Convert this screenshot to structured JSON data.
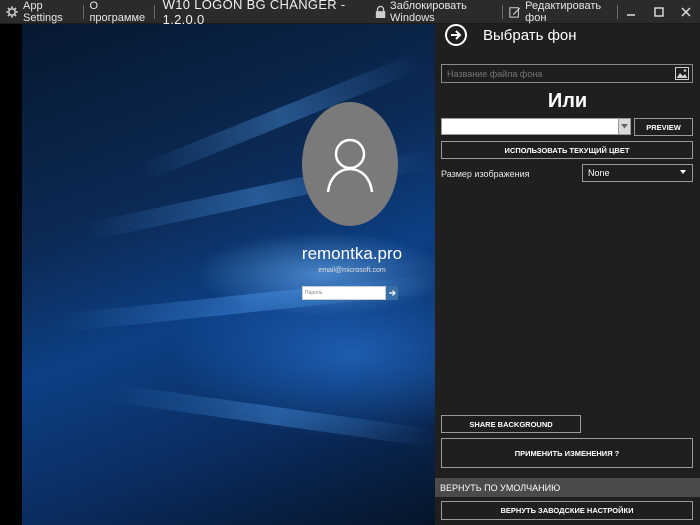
{
  "titlebar": {
    "app_settings": "App Settings",
    "about": "О программе",
    "title": "W10 LOGON BG CHANGER - 1.2.0.0",
    "lock_windows": "Заблокировать Windows",
    "edit_background": "Редактировать фон"
  },
  "preview": {
    "username": "remontka.pro",
    "email": "email@microsoft.com",
    "password_placeholder": "Пароль"
  },
  "panel": {
    "title": "Выбрать фон",
    "file_placeholder": "Название файла фона",
    "or_label": "Или",
    "preview_button": "PREVIEW",
    "use_current_color_button": "ИСПОЛЬЗОВАТЬ ТЕКУЩИЙ ЦВЕТ",
    "image_size_label": "Размер изображения",
    "image_size_value": "None",
    "share_button": "SHARE BACKGROUND",
    "apply_button": "ПРИМЕНИТЬ ИЗМЕНЕНИЯ ?",
    "reset_header": "ВЕРНУТЬ ПО УМОЛЧАНИЮ",
    "factory_reset_button": "ВЕРНУТЬ ЗАВОДСКИЕ НАСТРОЙКИ"
  },
  "icons": {
    "settings": "gear-icon",
    "lock": "lock-icon",
    "edit": "edit-icon",
    "minimize": "minimize-icon",
    "maximize": "maximize-icon",
    "close": "close-icon",
    "back": "arrow-right-icon",
    "browse": "image-icon"
  },
  "colors": {
    "titlebar_bg": "#2b2b2b",
    "panel_bg": "#1f1f1f",
    "reset_header_bg": "#4a4a4a"
  }
}
